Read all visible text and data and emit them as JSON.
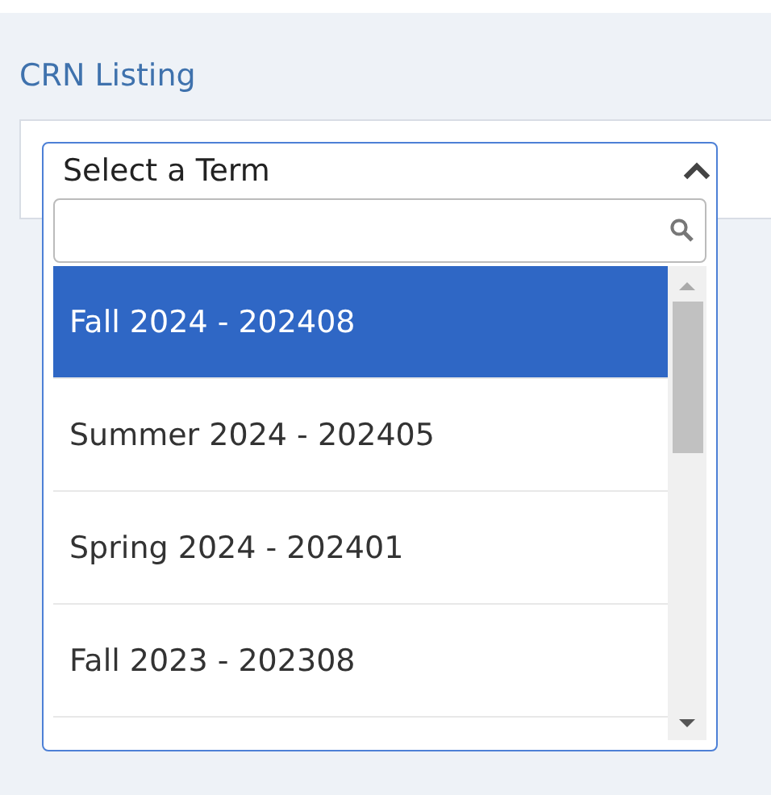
{
  "page_title": "CRN Listing",
  "term_select": {
    "label": "Select a Term",
    "expanded": true,
    "options": [
      {
        "label": "Fall 2024 - 202408",
        "selected": true
      },
      {
        "label": "Summer 2024 - 202405",
        "selected": false
      },
      {
        "label": "Spring 2024 - 202401",
        "selected": false
      },
      {
        "label": "Fall 2023 - 202308",
        "selected": false
      }
    ]
  }
}
